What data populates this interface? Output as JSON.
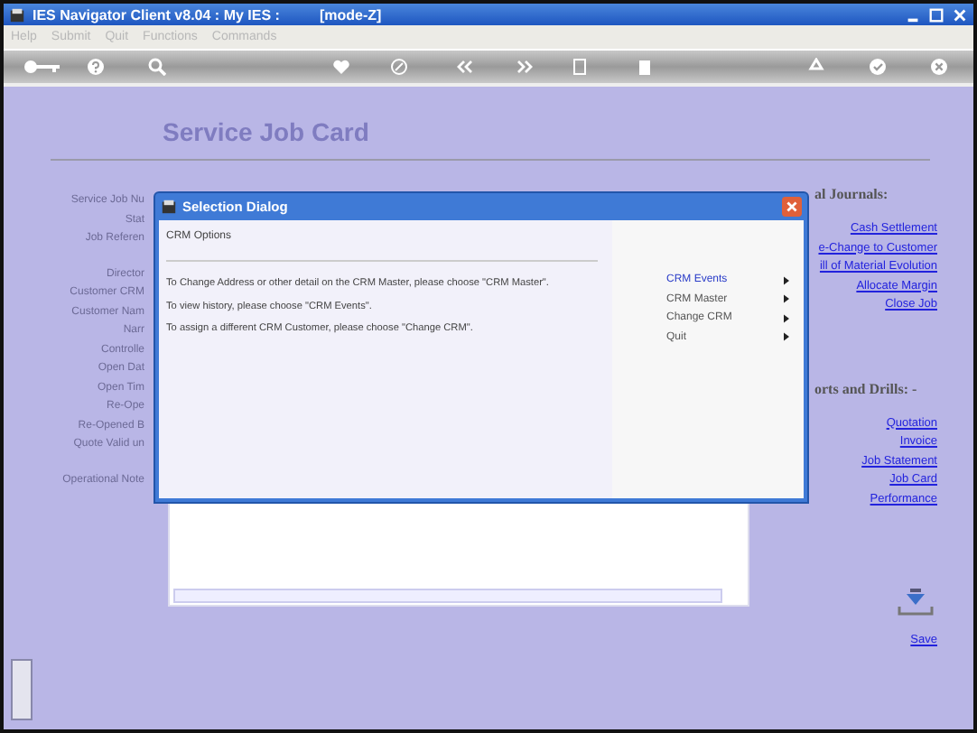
{
  "window": {
    "title": "IES Navigator Client v8.04 : My IES :",
    "mode": "[mode-Z]"
  },
  "menu": [
    "Help",
    "Submit",
    "Quit",
    "Functions",
    "Commands"
  ],
  "page_title": "Service Job Card",
  "label_groups": [
    [
      "Service Job Nu",
      "Stat",
      "Job Referen"
    ],
    [
      "Director",
      "Customer CRM",
      "Customer Nam",
      "Narr",
      "Controlle",
      "Open Dat",
      "Open Tim",
      "Re-Ope",
      "Re-Opened B",
      "Quote Valid un"
    ],
    [
      "Operational Note"
    ]
  ],
  "sections": [
    {
      "heading": "al Journals:",
      "links": [
        "Cash Settlement",
        "e-Change to Customer",
        "ill of Material Evolution",
        "Allocate Margin",
        "Close Job"
      ]
    },
    {
      "heading": "orts and Drills: -",
      "links": [
        "Quotation",
        "Invoice",
        "Job Statement",
        "Job Card",
        "Performance"
      ]
    }
  ],
  "save_label": "Save",
  "dialog": {
    "title": "Selection Dialog",
    "heading": "CRM Options",
    "lines": [
      "To Change Address or other detail on the CRM Master, please choose \"CRM Master\".",
      "To view history, please choose \"CRM Events\".",
      "To assign a different CRM Customer, please choose \"Change CRM\"."
    ],
    "options": [
      {
        "label": "CRM Events",
        "selected": true
      },
      {
        "label": "CRM Master",
        "selected": false
      },
      {
        "label": "Change CRM",
        "selected": false
      },
      {
        "label": "Quit",
        "selected": false
      }
    ]
  }
}
